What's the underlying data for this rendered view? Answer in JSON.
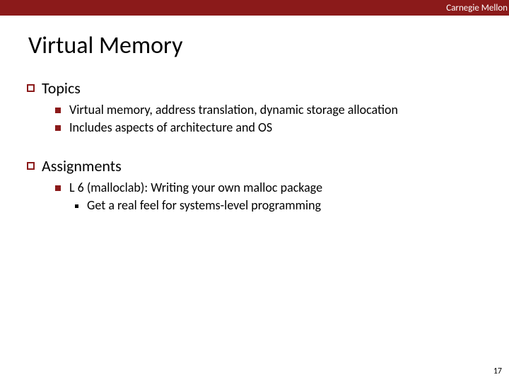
{
  "header": {
    "institution": "Carnegie Mellon"
  },
  "title": "Virtual Memory",
  "sections": [
    {
      "heading": "Topics",
      "items": [
        {
          "text": "Virtual memory, address translation, dynamic storage allocation"
        },
        {
          "text": "Includes aspects of architecture and OS"
        }
      ]
    },
    {
      "heading": "Assignments",
      "items": [
        {
          "text": "L 6 (malloclab): Writing your own malloc package",
          "subitems": [
            {
              "text": "Get a real feel for systems-level programming"
            }
          ]
        }
      ]
    }
  ],
  "page_number": "17"
}
